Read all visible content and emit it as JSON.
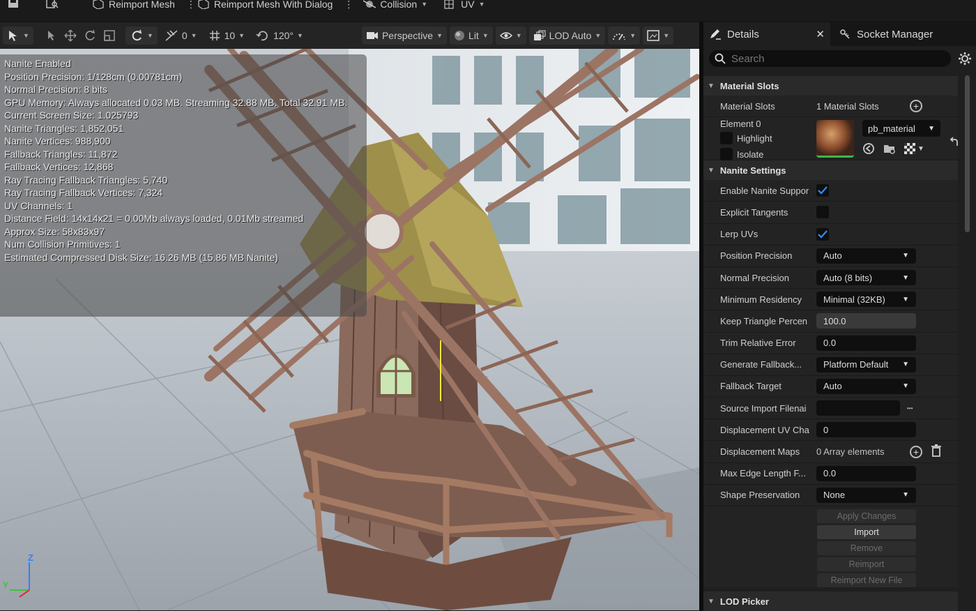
{
  "toolbar": {
    "reimport_mesh": "Reimport Mesh",
    "reimport_mesh_dialog": "Reimport Mesh With Dialog",
    "collision": "Collision",
    "uv": "UV"
  },
  "viewport_toolbar": {
    "rotate_snap": "0",
    "grid_snap": "10",
    "angle_snap": "120°",
    "perspective": "Perspective",
    "lit": "Lit",
    "lod": "LOD Auto"
  },
  "stats": [
    "Nanite Enabled",
    "Position Precision: 1/128cm (0.00781cm)",
    "Normal Precision: 8 bits",
    "GPU Memory: Always allocated 0.03 MB. Streaming 32.88 MB. Total 32.91 MB.",
    "Current Screen Size: 1.025793",
    "Nanite Triangles: 1,852,051",
    "Nanite Vertices: 988,900",
    "Fallback Triangles: 11,872",
    "Fallback Vertices: 12,868",
    "Ray Tracing Fallback Triangles: 5,740",
    "Ray Tracing Fallback Vertices: 7,324",
    "UV Channels: 1",
    "Distance Field: 14x14x21 = 0.00Mb always loaded, 0.01Mb streamed",
    "Approx Size: 58x83x97",
    "Num Collision Primitives: 1",
    "Estimated Compressed Disk Size: 16.26 MB (15.86 MB Nanite)"
  ],
  "gizmo": {
    "x": "Y",
    "z": "Z"
  },
  "panel": {
    "tab_details": "Details",
    "tab_socket": "Socket Manager",
    "search_placeholder": "Search",
    "material_section": "Material Slots",
    "material_slots_label": "Material Slots",
    "material_slots_value": "1 Material Slots",
    "element_label": "Element 0",
    "highlight": "Highlight",
    "isolate": "Isolate",
    "material_name": "pb_material",
    "nanite_section": "Nanite Settings",
    "lod_section": "LOD Picker",
    "rows": [
      {
        "label": "Enable Nanite Suppor",
        "type": "check",
        "checked": true
      },
      {
        "label": "Explicit Tangents",
        "type": "check",
        "checked": false
      },
      {
        "label": "Lerp UVs",
        "type": "check",
        "checked": true
      },
      {
        "label": "Position Precision",
        "type": "dropdown",
        "value": "Auto"
      },
      {
        "label": "Normal Precision",
        "type": "dropdown",
        "value": "Auto (8 bits)"
      },
      {
        "label": "Minimum Residency",
        "type": "dropdown",
        "value": "Minimal (32KB)"
      },
      {
        "label": "Keep Triangle Percen",
        "type": "field-light",
        "value": "100.0"
      },
      {
        "label": "Trim Relative Error",
        "type": "field",
        "value": "0.0"
      },
      {
        "label": "Generate Fallback...",
        "type": "dropdown",
        "value": "Platform Default"
      },
      {
        "label": "Fallback Target",
        "type": "dropdown",
        "value": "Auto"
      },
      {
        "label": "Source Import Filenai",
        "type": "file",
        "value": ""
      },
      {
        "label": "Displacement UV Cha",
        "type": "field",
        "value": "0"
      },
      {
        "label": "Displacement Maps",
        "type": "array",
        "value": "0 Array elements"
      },
      {
        "label": "Max Edge Length F...",
        "type": "field",
        "value": "0.0"
      },
      {
        "label": "Shape Preservation",
        "type": "dropdown",
        "value": "None"
      }
    ],
    "buttons": {
      "apply": "Apply Changes",
      "import": "Import",
      "remove": "Remove",
      "reimport": "Reimport",
      "reimport_new": "Reimport New File"
    }
  },
  "colors": {
    "accent_check": "#2f8fff",
    "panel_bg": "#1f1f1f",
    "gizmo_z": "#2f80ff",
    "gizmo_x": "#e03030",
    "gizmo_y": "#40c040"
  }
}
